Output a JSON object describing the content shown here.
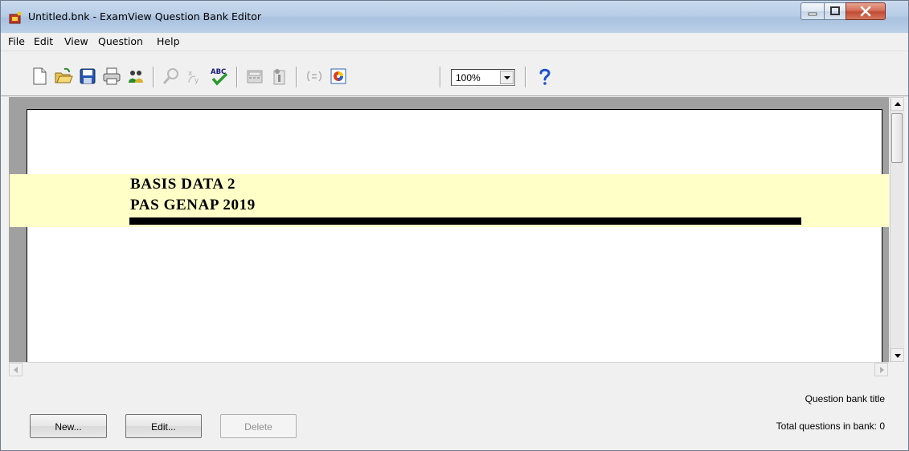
{
  "window": {
    "title": "Untitled.bnk - ExamView Question Bank Editor",
    "controls": {
      "minimize": "minimize",
      "maximize": "maximize",
      "close": "close"
    }
  },
  "menu": {
    "items": [
      "File",
      "Edit",
      "View",
      "Question",
      "Help"
    ]
  },
  "toolbar": {
    "buttons": [
      {
        "icon": "new-document-icon"
      },
      {
        "icon": "open-folder-icon"
      },
      {
        "icon": "save-icon"
      },
      {
        "icon": "print-icon"
      },
      {
        "icon": "users-icon"
      },
      {
        "icon": "find-icon"
      },
      {
        "icon": "replace-icon"
      },
      {
        "icon": "spell-check-icon"
      },
      {
        "icon": "calculator-icon"
      },
      {
        "icon": "info-icon"
      },
      {
        "icon": "equation-icon"
      },
      {
        "icon": "color-wheel-icon"
      },
      {
        "icon": "help-icon"
      }
    ],
    "zoom": "100%",
    "spellcheck_text": "ABC"
  },
  "document": {
    "line1": "BASIS DATA 2",
    "line2": "PAS GENAP 2019",
    "band_color": "#ffffc8"
  },
  "footer": {
    "new_label": "New...",
    "edit_label": "Edit...",
    "delete_label": "Delete",
    "bank_title_label": "Question bank title",
    "total_questions": "Total questions in bank: 0"
  }
}
